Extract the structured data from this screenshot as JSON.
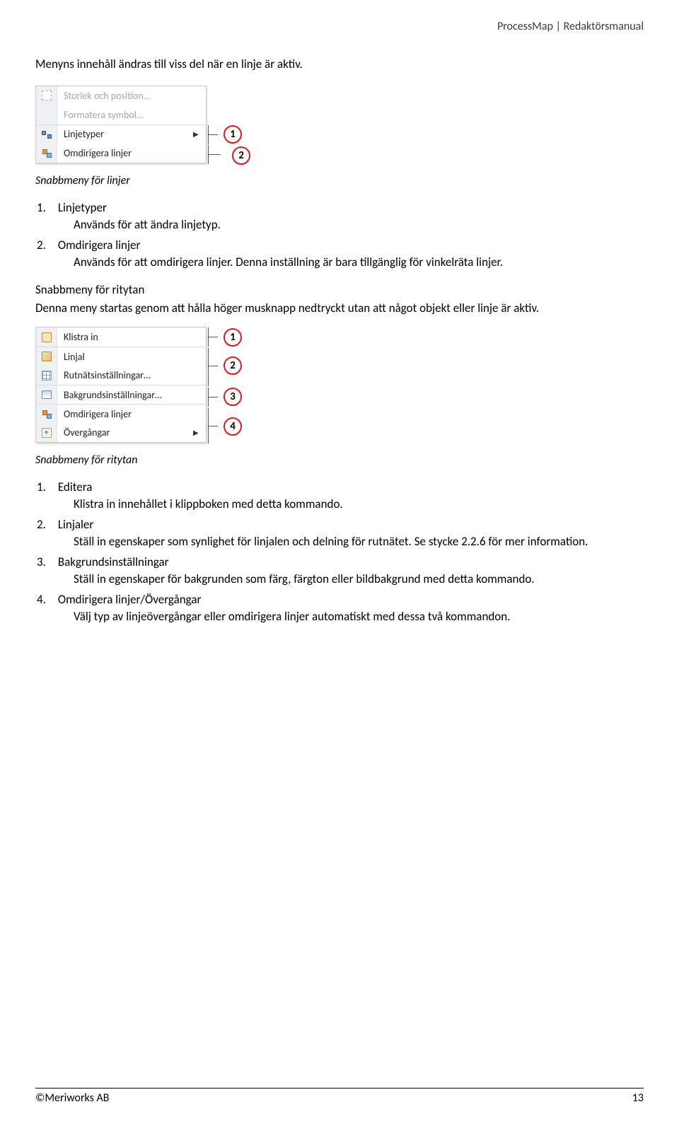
{
  "header": {
    "breadcrumb": "ProcessMap | Redaktörsmanual"
  },
  "intro1": "Menyns innehåll ändras till viss del när en linje är aktiv.",
  "menu1": {
    "m1": "Storlek och position…",
    "m2": "Formatera symbol…",
    "m3": "Linjetyper",
    "m4": "Omdirigera linjer"
  },
  "badges1": {
    "b1": "1",
    "b2": "2"
  },
  "caption1": "Snabbmeny för linjer",
  "list1": {
    "n1": "1.",
    "t1": "Linjetyper",
    "d1": "Används för att ändra linjetyp.",
    "n2": "2.",
    "t2": "Omdirigera linjer",
    "d2": "Används för att omdirigera linjer. Denna inställning är bara tillgänglig för vinkelräta linjer."
  },
  "section2_heading": "Snabbmeny för ritytan",
  "section2_body": "Denna meny startas genom att hålla höger musknapp nedtryckt utan att något objekt eller linje är aktiv.",
  "menu2": {
    "m1": "Klistra in",
    "m2": "Linjal",
    "m3": "Rutnätsinställningar…",
    "m4": "Bakgrundsinställningar…",
    "m5": "Omdirigera linjer",
    "m6": "Övergångar"
  },
  "badges2": {
    "b1": "1",
    "b2": "2",
    "b3": "3",
    "b4": "4"
  },
  "caption2": "Snabbmeny för ritytan",
  "list2": {
    "n1": "1.",
    "t1": "Editera",
    "d1": "Klistra in innehållet i klippboken med detta kommando.",
    "n2": "2.",
    "t2": "Linjaler",
    "d2": "Ställ in egenskaper som synlighet för linjalen och delning för rutnätet. Se stycke 2.2.6 för mer information.",
    "n3": "3.",
    "t3": "Bakgrundsinställningar",
    "d3": "Ställ in egenskaper för bakgrunden som färg, färgton eller bildbakgrund med detta kommando.",
    "n4": "4.",
    "t4": "Omdirigera linjer/Övergångar",
    "d4": "Välj typ av linjeövergångar eller omdirigera linjer automatiskt med dessa två kommandon."
  },
  "footer": {
    "left": "©Meriworks AB",
    "right": "13"
  }
}
